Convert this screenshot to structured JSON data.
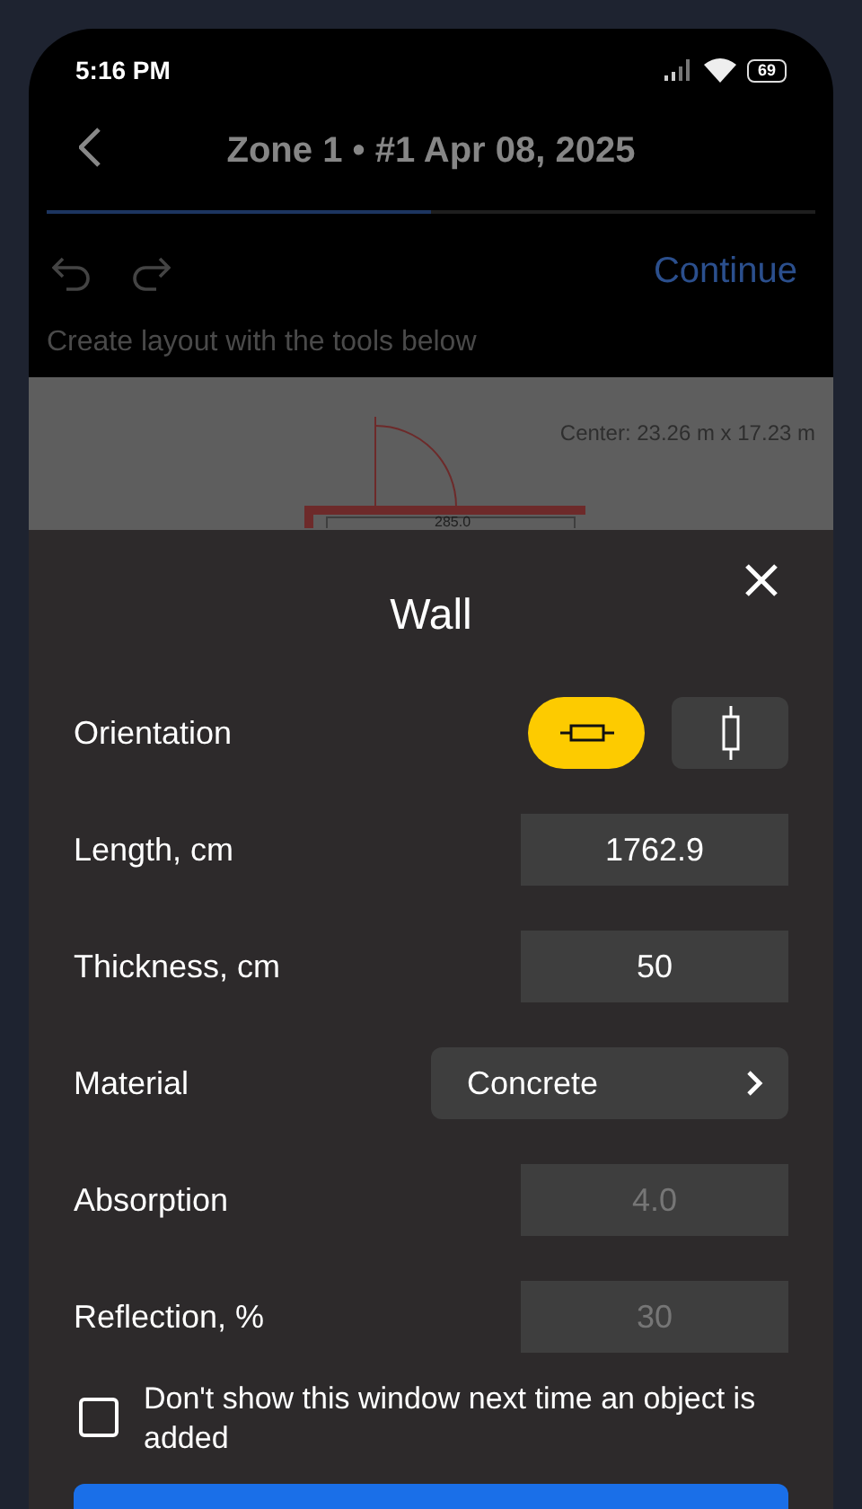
{
  "status_bar": {
    "time": "5:16 PM",
    "battery": "69"
  },
  "header": {
    "title": "Zone 1 • #1 Apr 08, 2025",
    "progress": {
      "level": 0.5
    }
  },
  "toolbar": {
    "action": "Continue",
    "hint": "Create layout with the tools below"
  },
  "canvas": {
    "center_label": "Center: 23.26 m x 17.23 m",
    "dimension": "285.0"
  },
  "sheet": {
    "title": "Wall",
    "rows": [
      {
        "kind": "orientation",
        "label": "Orientation",
        "options": [
          {
            "kind": "horizontal",
            "selected": true
          },
          {
            "kind": "vertical",
            "selected": false
          }
        ]
      },
      {
        "kind": "number",
        "label": "Length, cm",
        "value": "1762.9",
        "disabled": false
      },
      {
        "kind": "number",
        "label": "Thickness, cm",
        "value": "50",
        "disabled": false
      },
      {
        "kind": "select",
        "label": "Material",
        "value": "Concrete"
      },
      {
        "kind": "number",
        "label": "Absorption",
        "value": "4.0",
        "disabled": true
      },
      {
        "kind": "number",
        "label": "Reflection, %",
        "value": "30",
        "disabled": true
      }
    ],
    "checkbox": {
      "label": "Don't show this window next time an object is added",
      "checked": false
    }
  }
}
